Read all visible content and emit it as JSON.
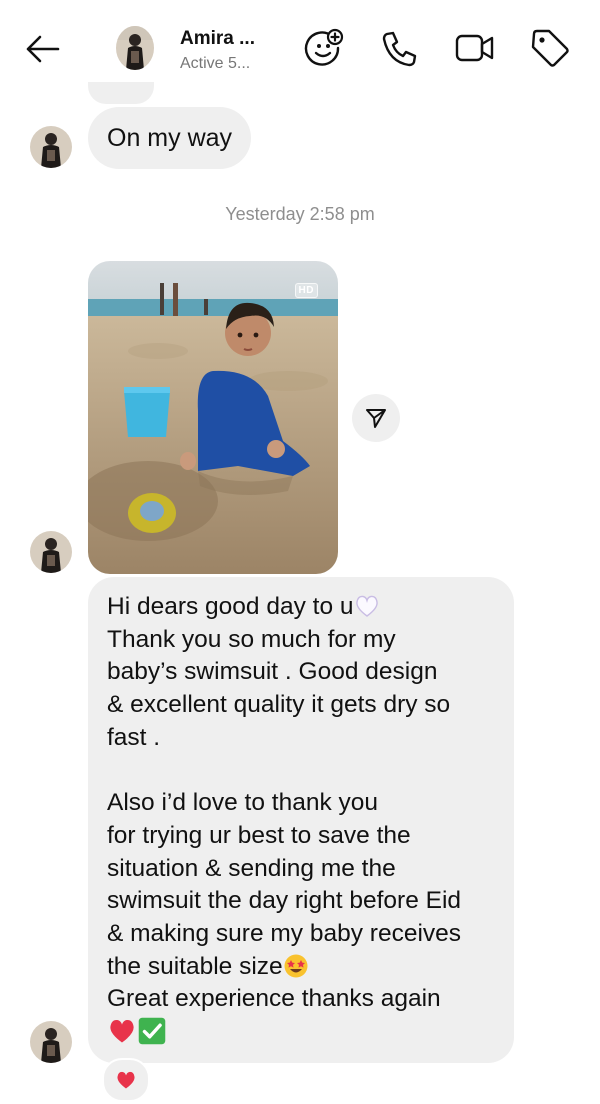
{
  "header": {
    "contact_name": "Amira ...",
    "status": "Active 5...",
    "icons": [
      "back-arrow-icon",
      "effects-add-icon",
      "phone-icon",
      "video-camera-icon",
      "tag-icon"
    ]
  },
  "messages": {
    "m1_text": "On my way",
    "timestamp": "Yesterday 2:58 pm",
    "photo_badge": "HD",
    "m2_lines": [
      "Hi dears good day to u",
      "Thank you so much for my",
      "baby’s swimsuit . Good design",
      "& excellent quality it gets dry so",
      "fast .",
      "",
      "Also i’d love to thank you",
      "for trying ur best to save the",
      "situation & sending me the",
      "swimsuit the day right before Eid",
      "& making sure my baby receives",
      "the suitable size",
      "Great experience thanks again"
    ],
    "m2_emojis": [
      "white-heart",
      "star-struck-face",
      "red-heart",
      "check-mark-button"
    ],
    "reaction": "red-heart"
  },
  "colors": {
    "bubble": "#efefef",
    "timestamp": "#8e8e8e",
    "status": "#777777",
    "heart": "#e8334a",
    "check": "#3fb34f"
  }
}
